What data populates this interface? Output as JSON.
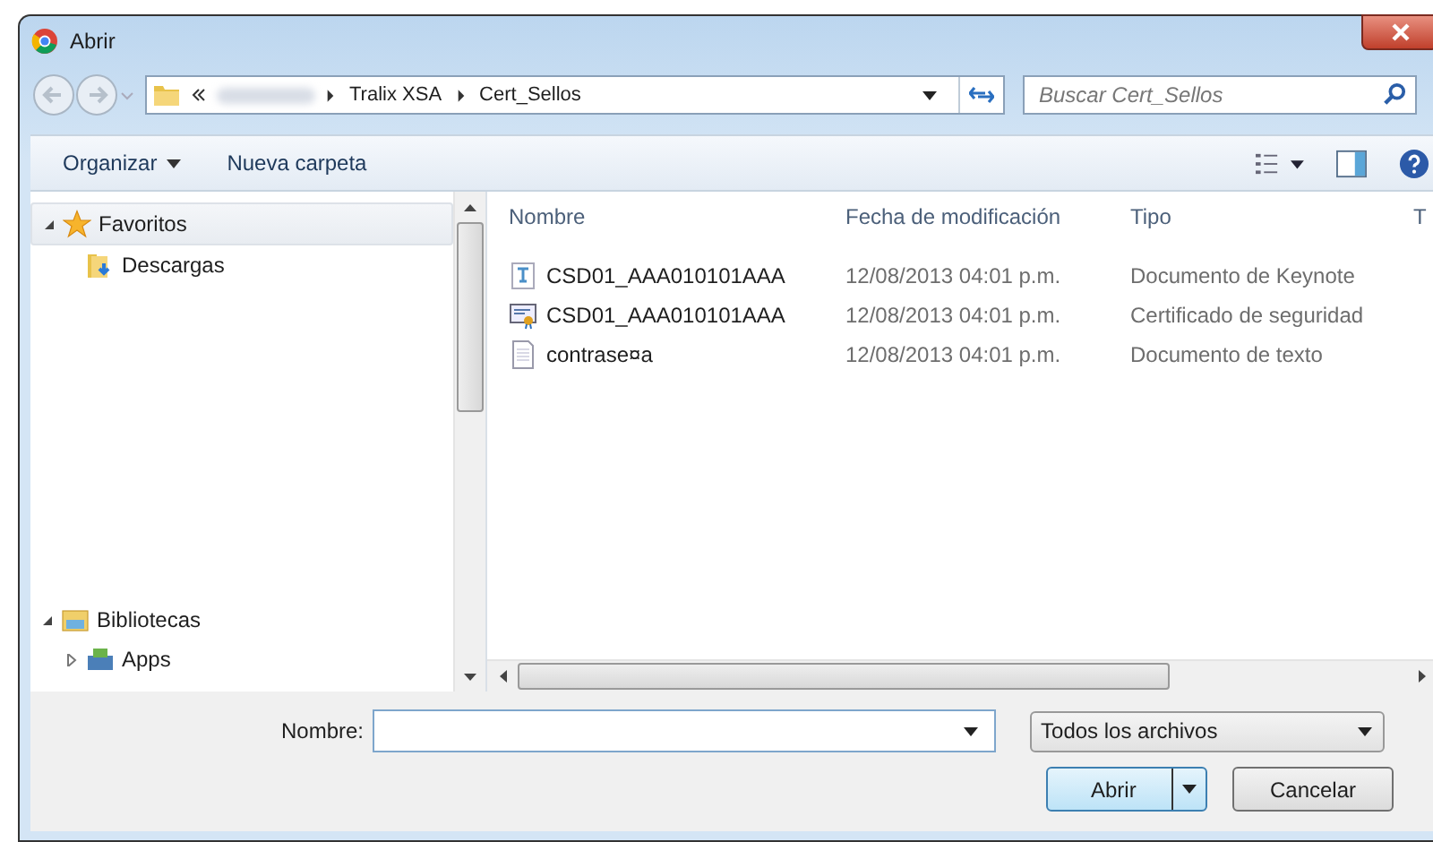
{
  "window": {
    "title": "Abrir"
  },
  "address_bar": {
    "segments": [
      "Tralix XSA",
      "Cert_Sellos"
    ]
  },
  "search": {
    "placeholder": "Buscar Cert_Sellos"
  },
  "toolbar": {
    "buttons": [
      {
        "label": "Organizar",
        "dropdown": true
      },
      {
        "label": "Nueva carpeta",
        "dropdown": false
      }
    ]
  },
  "sidebar": {
    "items": [
      {
        "label": "Favoritos",
        "kind": "favorites",
        "expanded": true,
        "selected": true,
        "children": [
          {
            "label": "Descargas",
            "kind": "downloads",
            "selected": false
          }
        ]
      },
      {
        "label": "Bibliotecas",
        "kind": "libraries",
        "expanded": true,
        "selected": false,
        "children": [
          {
            "label": "Apps",
            "kind": "apps",
            "expanded": false,
            "selected": false
          }
        ]
      }
    ]
  },
  "table": {
    "columns": [
      "Nombre",
      "Fecha de modificación",
      "Tipo",
      "T"
    ],
    "rows": [
      {
        "kind": "keynote",
        "name": "CSD01_AAA010101AAA",
        "date": "12/08/2013 04:01 p.m.",
        "type": "Documento de Keynote"
      },
      {
        "kind": "certificate",
        "name": "CSD01_AAA010101AAA",
        "date": "12/08/2013 04:01 p.m.",
        "type": "Certificado de seguridad"
      },
      {
        "kind": "text",
        "name": "contrase¤a",
        "date": "12/08/2013 04:01 p.m.",
        "type": "Documento de texto"
      }
    ]
  },
  "filename": {
    "label": "Nombre:"
  },
  "filter": {
    "value": "Todos los archivos"
  },
  "buttons": [
    {
      "label": "Abrir",
      "kind": "split"
    },
    {
      "label": "Cancelar",
      "kind": "plain"
    }
  ]
}
